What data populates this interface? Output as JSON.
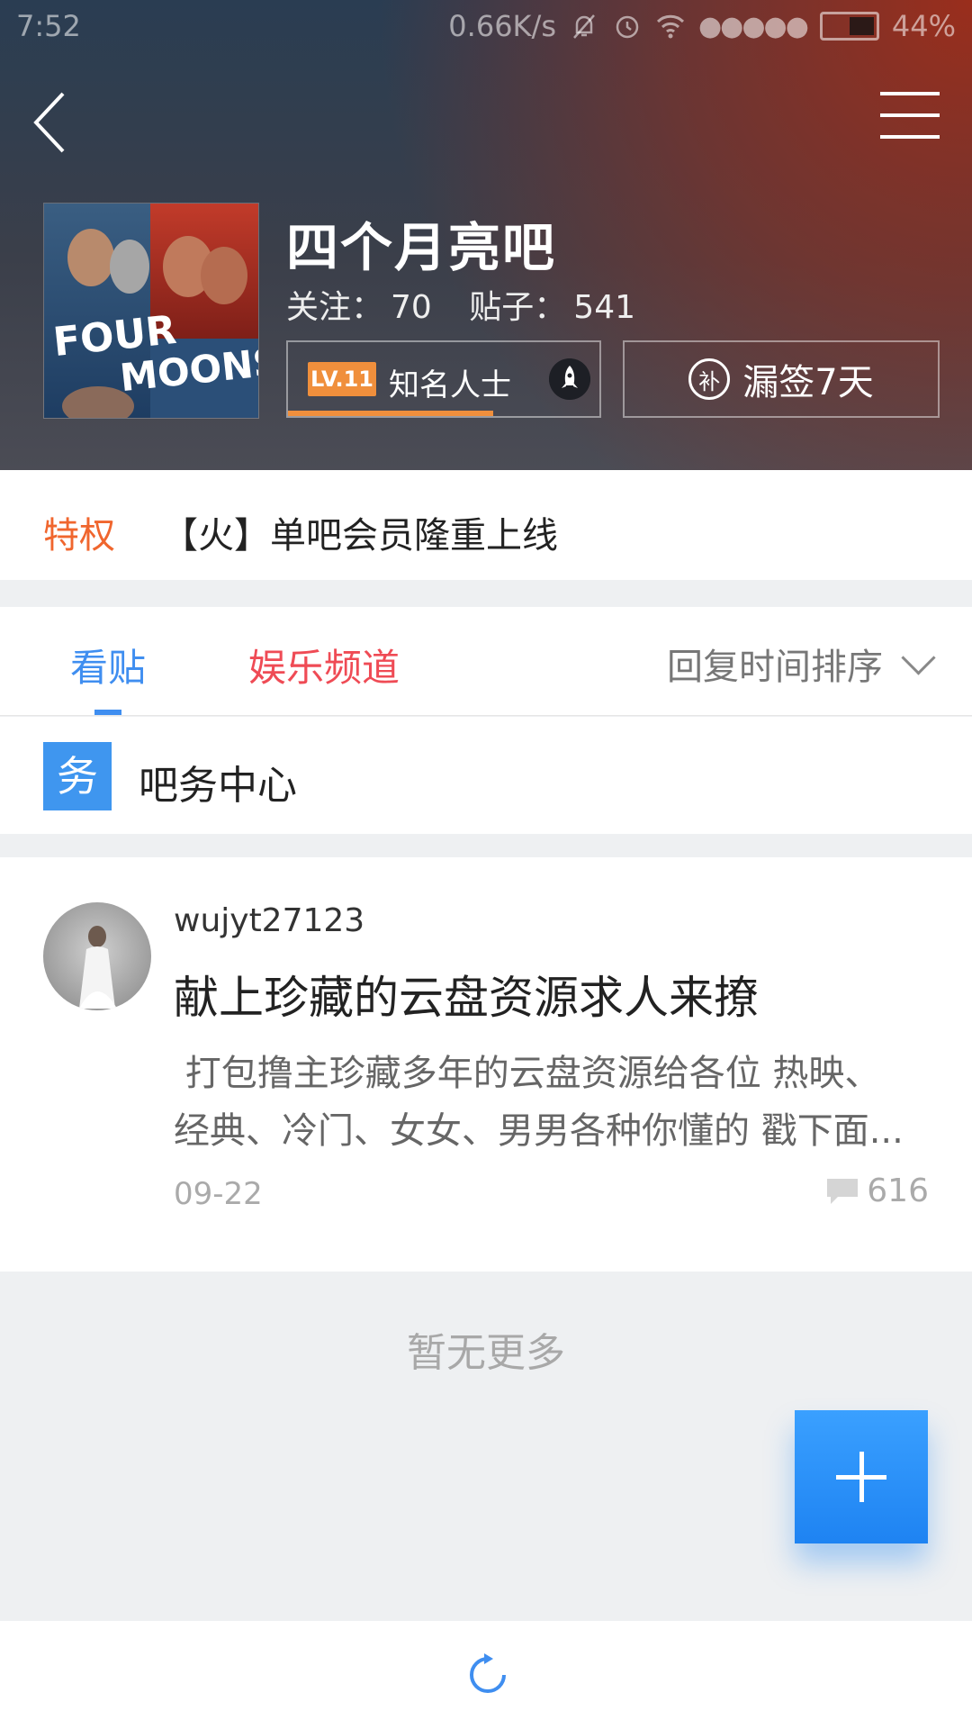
{
  "status_bar": {
    "time": "7:52",
    "speed": "0.66K/s",
    "signal": "●●●●●",
    "battery": "44%"
  },
  "header": {
    "bar_name": "四个月亮吧",
    "follow_label": "关注：",
    "follow_count": "70",
    "posts_label": "贴子：",
    "posts_count": "541",
    "level_badge": "LV.11",
    "level_title": "知名人士",
    "level_progress": 0.66,
    "sign_icon_text": "补",
    "sign_label": "漏签7天",
    "cover_text_line1": "FOUR",
    "cover_text_line2": "MOONS"
  },
  "privilege": {
    "tag": "特权",
    "text": "【火】单吧会员隆重上线"
  },
  "tabs": {
    "items": [
      {
        "label": "看贴",
        "active": true
      },
      {
        "label": "娱乐频道",
        "active": false
      }
    ],
    "sort_label": "回复时间排序"
  },
  "service": {
    "icon_text": "务",
    "label": "吧务中心"
  },
  "post": {
    "author": "wujyt27123",
    "title": "献上珍藏的云盘资源求人来撩",
    "excerpt_line1": " 打包撸主珍藏多年的云盘资源给各位 热映、",
    "excerpt_line2": "经典、冷门、女女、男男各种你懂的 戳下面...",
    "date": "09-22",
    "comment_count": "616"
  },
  "footer": {
    "no_more": "暂无更多"
  },
  "colors": {
    "accent_blue": "#3f8ef0",
    "level_orange": "#f08f3c",
    "privilege_red": "#f0662e",
    "channel_red": "#ef4b55"
  }
}
